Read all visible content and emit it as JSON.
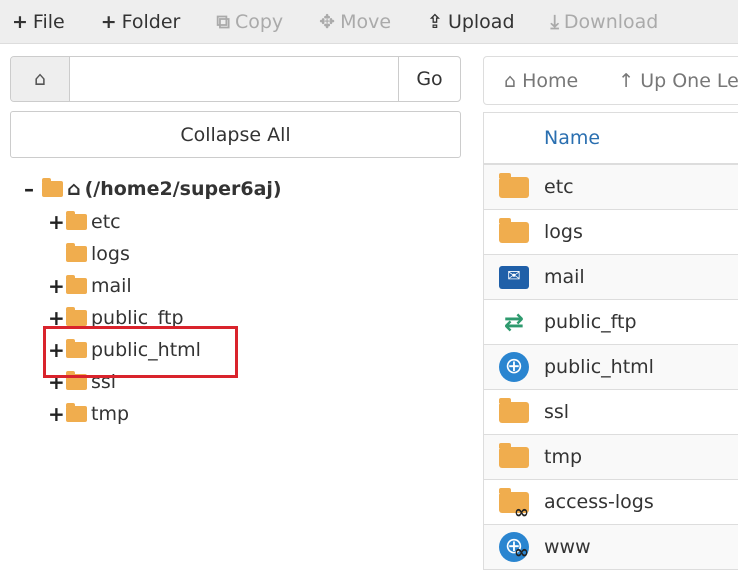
{
  "toolbar": {
    "file": "File",
    "folder": "Folder",
    "copy": "Copy",
    "move": "Move",
    "upload": "Upload",
    "download": "Download"
  },
  "address": {
    "value": "",
    "go": "Go"
  },
  "collapse_all": "Collapse All",
  "tree": {
    "root": "(/home2/super6aj)",
    "items": [
      "etc",
      "logs",
      "mail",
      "public_ftp",
      "public_html",
      "ssl",
      "tmp"
    ]
  },
  "breadcrumbs": {
    "home": "Home",
    "up": "Up One Level"
  },
  "table": {
    "header_name": "Name",
    "rows": [
      "etc",
      "logs",
      "mail",
      "public_ftp",
      "public_html",
      "ssl",
      "tmp",
      "access-logs",
      "www"
    ]
  },
  "highlight_color": "#d9232c"
}
